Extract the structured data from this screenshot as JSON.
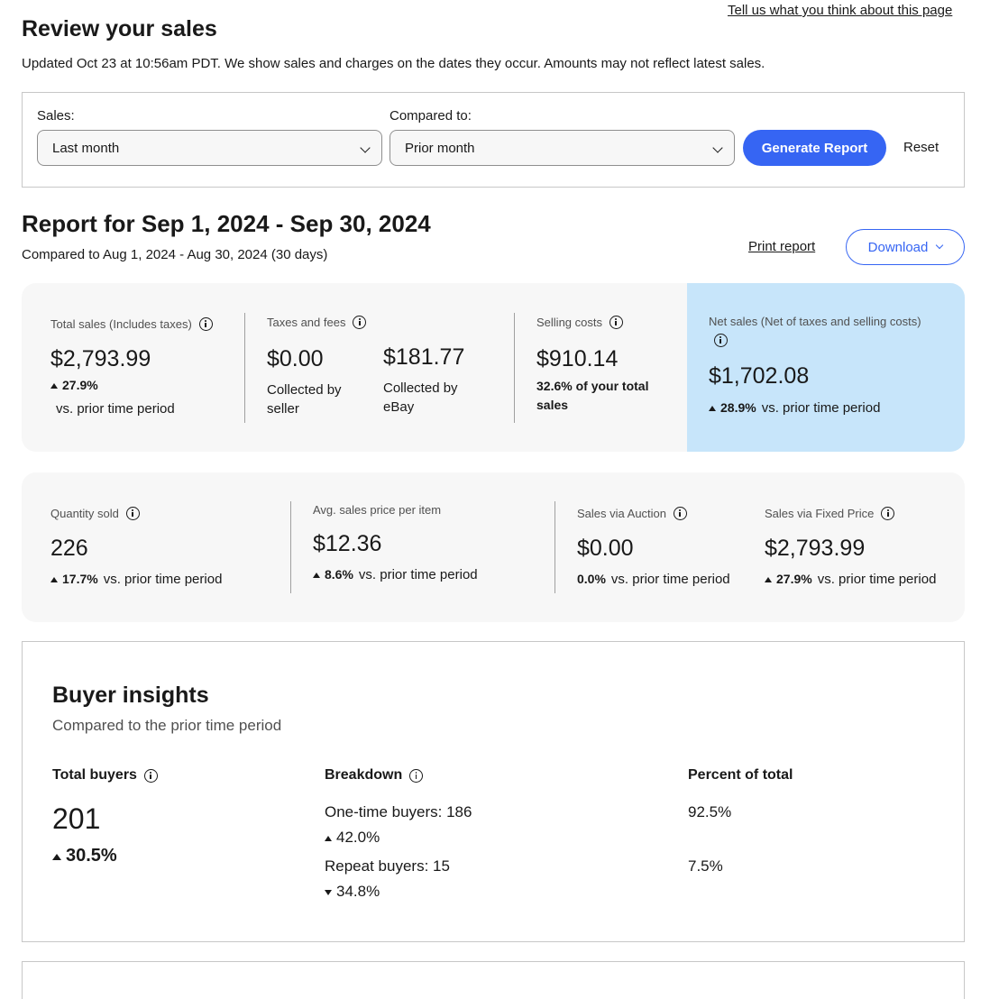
{
  "header": {
    "feedback_link": "Tell us what you think about this page",
    "title": "Review your sales",
    "updated": "Updated Oct 23 at 10:56am PDT. We show sales and charges on the dates they occur. Amounts may not reflect latest sales."
  },
  "filters": {
    "sales_label": "Sales:",
    "sales_value": "Last month",
    "compared_label": "Compared to:",
    "compared_value": "Prior month",
    "generate_label": "Generate Report",
    "reset_label": "Reset"
  },
  "report": {
    "title": "Report for Sep 1, 2024 - Sep 30, 2024",
    "compared": "Compared to Aug 1, 2024 - Aug 30, 2024 (30 days)",
    "print_label": "Print report",
    "download_label": "Download"
  },
  "summary": {
    "total_sales": {
      "label": "Total sales (Includes taxes)",
      "value": "$2,793.99",
      "change": "27.9%",
      "change_text": "vs. prior time period"
    },
    "taxes_fees": {
      "label": "Taxes and fees",
      "seller_value": "$0.00",
      "seller_text_1": "Collected by",
      "seller_text_2": "seller",
      "ebay_value": "$181.77",
      "ebay_text_1": "Collected by",
      "ebay_text_2": "eBay"
    },
    "selling_costs": {
      "label": "Selling costs",
      "value": "$910.14",
      "note_1": "32.6% of your total",
      "note_2": "sales"
    },
    "net_sales": {
      "label": "Net sales (Net of taxes and selling costs)",
      "value": "$1,702.08",
      "change": "28.9%",
      "change_text": "vs. prior time period"
    }
  },
  "items": {
    "quantity": {
      "label": "Quantity sold",
      "value": "226",
      "change": "17.7%",
      "change_text": "vs. prior time period"
    },
    "avg_price": {
      "label": "Avg. sales price per item",
      "value": "$12.36",
      "change": "8.6%",
      "change_text": "vs. prior time period"
    },
    "auction": {
      "label": "Sales via Auction",
      "value": "$0.00",
      "change": "0.0%",
      "change_text": "vs. prior time period"
    },
    "fixed": {
      "label": "Sales via Fixed Price",
      "value": "$2,793.99",
      "change": "27.9%",
      "change_text": "vs. prior time period"
    }
  },
  "insights": {
    "title": "Buyer insights",
    "subtitle": "Compared to the prior time period",
    "total_head": "Total buyers",
    "breakdown_head": "Breakdown",
    "percent_head": "Percent of total",
    "total_value": "201",
    "total_change": "30.5%",
    "one_time": {
      "label": "One-time buyers: 186",
      "change": "42.0%",
      "percent": "92.5%"
    },
    "repeat": {
      "label": "Repeat buyers: 15",
      "change": "34.8%",
      "percent": "7.5%"
    }
  }
}
